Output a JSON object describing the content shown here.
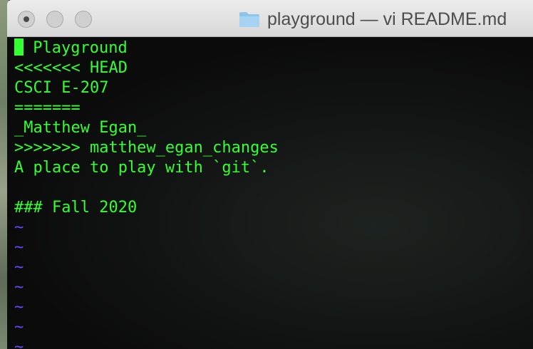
{
  "window": {
    "title": "playground — vi README.md",
    "folder_icon": "folder-icon",
    "buttons": [
      "close-button",
      "minimize-button",
      "zoom-button"
    ]
  },
  "editor": {
    "text_color": "#33ff33",
    "tilde_color": "#6a45ff",
    "cursor_char": "",
    "lines": [
      " Playground",
      "<<<<<<< HEAD",
      "CSCI E-207",
      "=======",
      "_Matthew Egan_",
      ">>>>>>> matthew_egan_changes",
      "A place to play with `git`.",
      "",
      "### Fall 2020"
    ],
    "empty_markers": [
      "~",
      "~",
      "~",
      "~",
      "~",
      "~",
      "~"
    ]
  }
}
